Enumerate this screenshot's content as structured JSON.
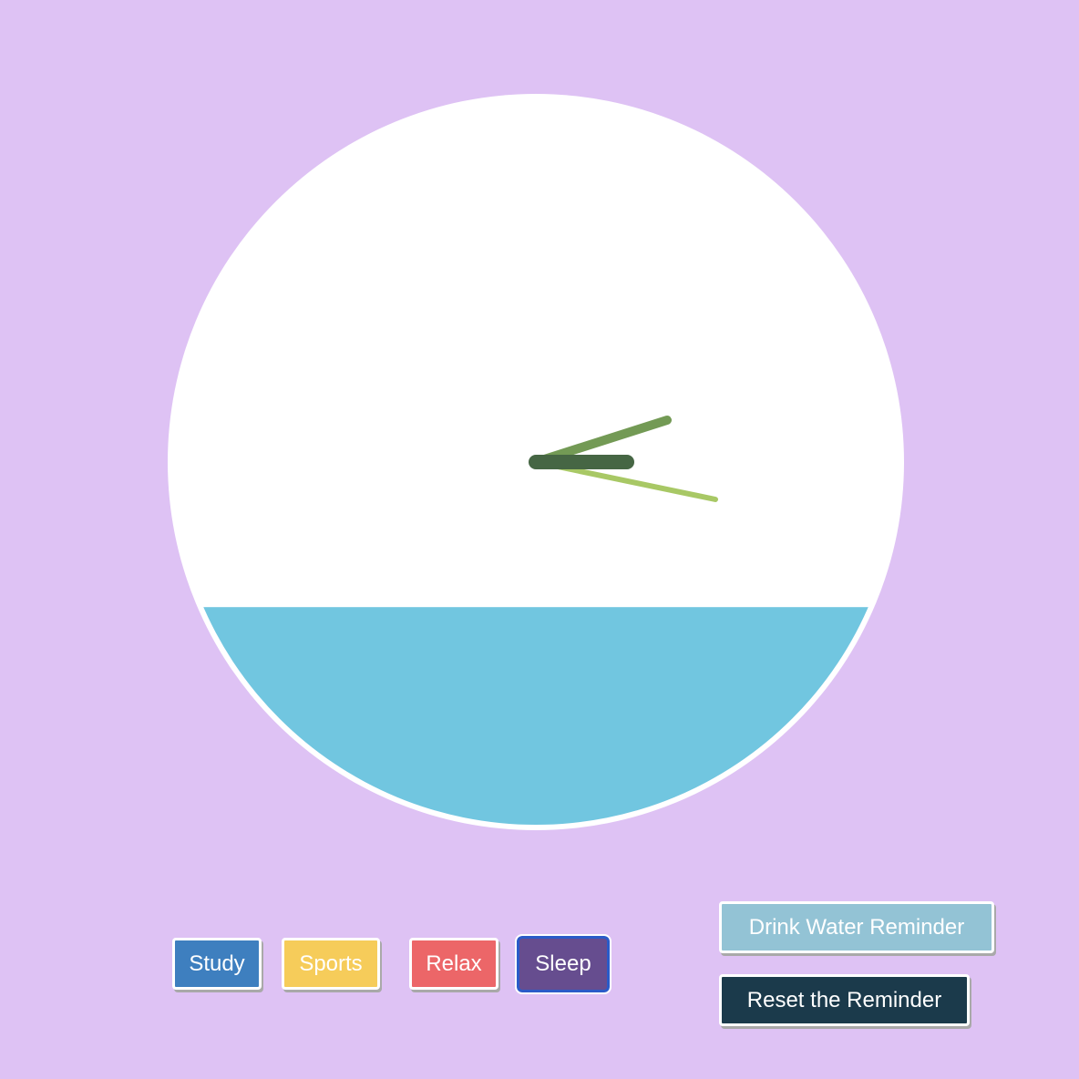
{
  "clock": {
    "face_color": "#ffffff",
    "water_color": "#71c6e0",
    "water_level_fraction": 0.3,
    "hour_hand_color": "#466644",
    "minute_hand_color": "#739a55",
    "second_hand_color": "#a8c865"
  },
  "activities": [
    {
      "label": "Study",
      "color": "#3e7fbf"
    },
    {
      "label": "Sports",
      "color": "#f6cc5a"
    },
    {
      "label": "Relax",
      "color": "#ec6668"
    },
    {
      "label": "Sleep",
      "color": "#664d8f"
    }
  ],
  "reminder": {
    "drink_label": "Drink Water Reminder",
    "drink_color": "#93c3d5",
    "reset_label": "Reset the Reminder",
    "reset_color": "#1b3a4b"
  }
}
